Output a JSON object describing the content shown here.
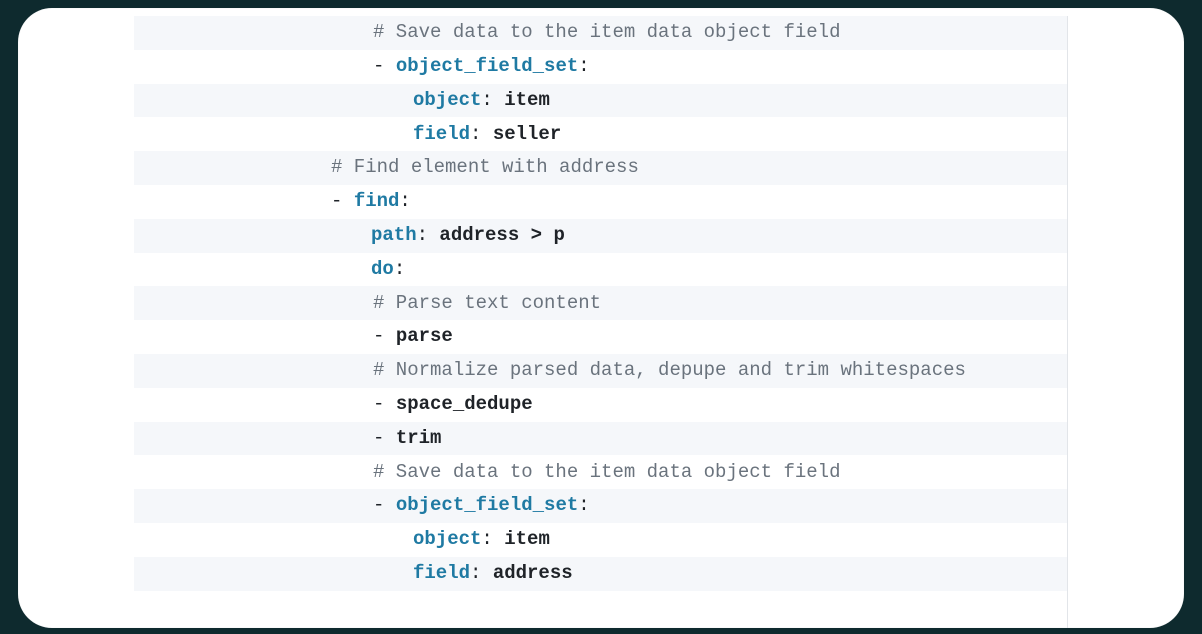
{
  "lines": {
    "l1_comment": "# Save data to the item data object field",
    "l2_dash": "- ",
    "l2_key": "object_field_set",
    "l2_colon": ":",
    "l3_key": "object",
    "l3_colon": ": ",
    "l3_val": "item",
    "l4_key": "field",
    "l4_colon": ": ",
    "l4_val": "seller",
    "l5_comment": "# Find element with address",
    "l6_dash": "- ",
    "l6_key": "find",
    "l6_colon": ":",
    "l7_key": "path",
    "l7_colon": ": ",
    "l7_val": "address > p",
    "l8_key": "do",
    "l8_colon": ":",
    "l9_comment": "# Parse text content",
    "l10_dash": "- ",
    "l10_val": "parse",
    "l11_comment": "# Normalize parsed data, depupe and trim whitespaces",
    "l12_dash": "- ",
    "l12_val": "space_dedupe",
    "l13_dash": "- ",
    "l13_val": "trim",
    "l14_comment": "# Save data to the item data object field",
    "l15_dash": "- ",
    "l15_key": "object_field_set",
    "l15_colon": ":",
    "l16_key": "object",
    "l16_colon": ": ",
    "l16_val": "item",
    "l17_key": "field",
    "l17_colon": ": ",
    "l17_val": "address"
  }
}
